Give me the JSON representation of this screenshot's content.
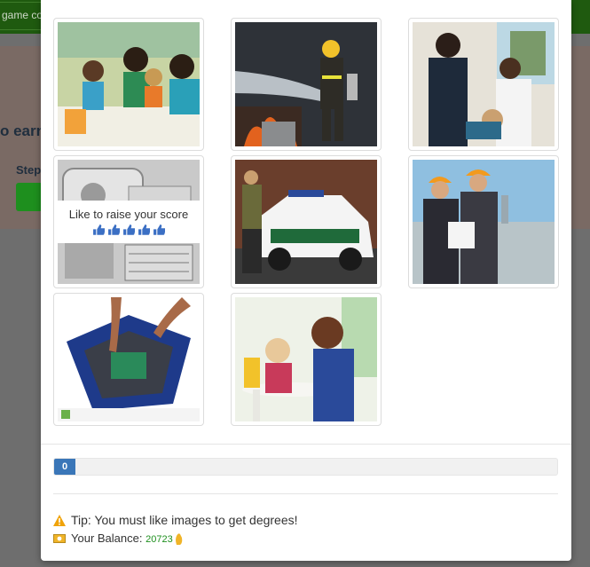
{
  "background": {
    "tab_text": "game co",
    "band_text": "o earn",
    "step_text": "Step"
  },
  "gallery": {
    "images": [
      {
        "name": "teacher-with-children",
        "liked": false
      },
      {
        "name": "firefighter-spraying",
        "liked": false
      },
      {
        "name": "dentist-and-patient",
        "liked": false
      },
      {
        "name": "mri-scanner",
        "liked": false
      },
      {
        "name": "sheriff-car",
        "liked": false
      },
      {
        "name": "engineers-with-hardhats",
        "liked": false
      },
      {
        "name": "computer-repair",
        "liked": false
      },
      {
        "name": "mother-and-child-drawing",
        "liked": false
      }
    ],
    "overlay": {
      "text": "Like to raise your score",
      "thumbs_count": 5
    }
  },
  "progress": {
    "value": 0,
    "label": "0"
  },
  "tip": {
    "icon": "warning-icon",
    "text": "Tip: You must like images to get degrees!"
  },
  "balance": {
    "icon": "money-icon",
    "label": "Your Balance:",
    "value": "20723",
    "coin_icon": "coin-icon"
  },
  "colors": {
    "accent": "#3a76b8",
    "success": "#1e8f1e",
    "warning": "#f0a30a"
  }
}
